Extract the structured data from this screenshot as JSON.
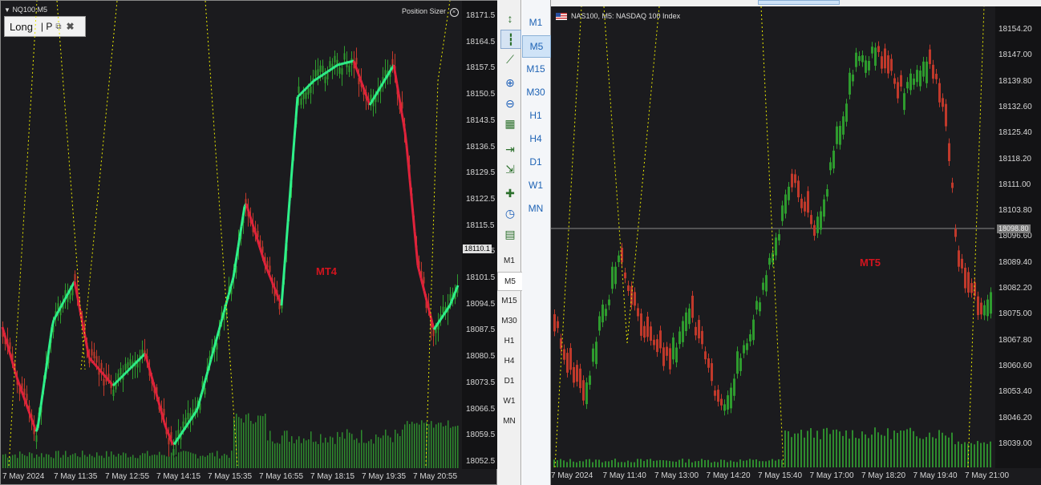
{
  "mt4": {
    "chart_title": "NQ100,M5",
    "position_sizer_label": "Position Sizer",
    "panel": {
      "direction": "Long",
      "sep": "| P"
    },
    "watermark": "MT4",
    "price_tag": "18110.1",
    "price_labels": [
      "18171.5",
      "18164.5",
      "18157.5",
      "18150.5",
      "18143.5",
      "18136.5",
      "18129.5",
      "18122.5",
      "18115.5",
      "18108.5",
      "18101.5",
      "18094.5",
      "18087.5",
      "18080.5",
      "18073.5",
      "18066.5",
      "18059.5",
      "18052.5"
    ],
    "time_labels": [
      "7 May 2024",
      "7 May 11:35",
      "7 May 12:55",
      "7 May 14:15",
      "7 May 15:35",
      "7 May 16:55",
      "7 May 18:15",
      "7 May 19:35",
      "7 May 20:55"
    ]
  },
  "toolbar": {
    "icons": [
      "period-separators-icon",
      "bar-chart-icon",
      "line-chart-icon",
      "zoom-in-icon",
      "zoom-out-icon",
      "tile-windows-icon",
      "chart-shift-icon",
      "auto-scroll-icon",
      "new-chart-icon",
      "clock-icon",
      "templates-icon"
    ],
    "timeframes": [
      "M1",
      "M5",
      "M15",
      "M30",
      "H1",
      "H4",
      "D1",
      "W1",
      "MN"
    ],
    "selected": "M5"
  },
  "mt5_sidebar": {
    "timeframes": [
      "M1",
      "M5",
      "M15",
      "M30",
      "H1",
      "H4",
      "D1",
      "W1",
      "MN"
    ],
    "selected": "M5"
  },
  "mt5": {
    "chart_title": "NAS100, M5:  NASDAQ 100 Index",
    "watermark": "MT5",
    "price_tag": "18098.80",
    "price_labels": [
      "18154.20",
      "18147.00",
      "18139.80",
      "18132.60",
      "18125.40",
      "18118.20",
      "18111.00",
      "18103.80",
      "18096.60",
      "18089.40",
      "18082.20",
      "18075.00",
      "18067.80",
      "18060.60",
      "18053.40",
      "18046.20",
      "18039.00"
    ],
    "time_labels": [
      "7 May 2024",
      "7 May 11:40",
      "7 May 13:00",
      "7 May 14:20",
      "7 May 15:40",
      "7 May 17:00",
      "7 May 18:20",
      "7 May 19:40",
      "7 May 21:00"
    ]
  },
  "colors": {
    "bull": "#2e9b2e",
    "bear": "#c0392b",
    "hl_bull": "#2ef08a",
    "hl_bear": "#e0223b",
    "dotted": "#e6e600",
    "volume": "#2e8b2e",
    "watermark": "#d2141e"
  }
}
